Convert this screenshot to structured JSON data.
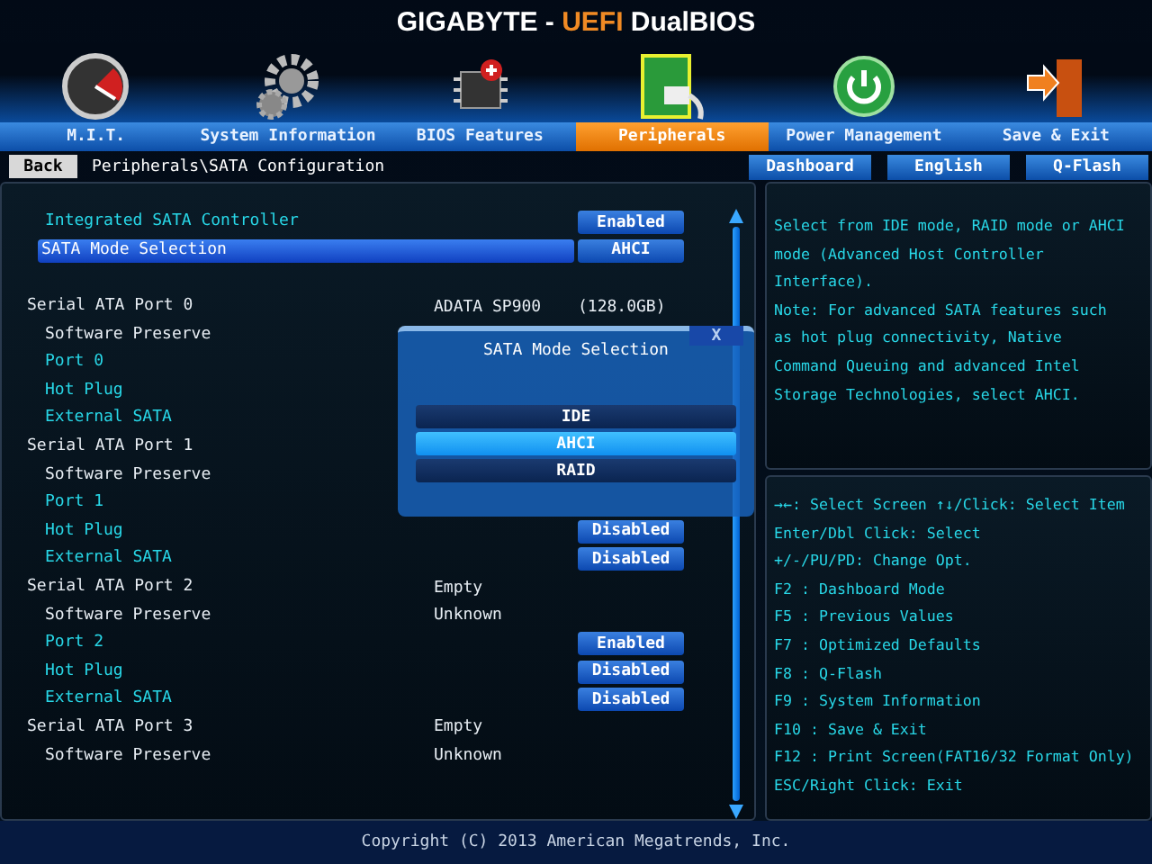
{
  "title": {
    "brand": "GIGABYTE - ",
    "uefi": "UEFI",
    "rest": " DualBIOS"
  },
  "tabs": [
    {
      "label": "M.I.T.",
      "selected": false
    },
    {
      "label": "System Information",
      "selected": false
    },
    {
      "label": "BIOS Features",
      "selected": false
    },
    {
      "label": "Peripherals",
      "selected": true
    },
    {
      "label": "Power Management",
      "selected": false
    },
    {
      "label": "Save & Exit",
      "selected": false
    }
  ],
  "back_button": "Back",
  "breadcrumb": "Peripherals\\SATA Configuration",
  "shortcuts": [
    "Dashboard",
    "English",
    "Q-Flash"
  ],
  "settings": [
    {
      "kind": "option",
      "label": "Integrated SATA Controller",
      "value": "Enabled",
      "selected": false
    },
    {
      "kind": "option",
      "label": "SATA Mode Selection",
      "value": "AHCI",
      "selected": true
    },
    {
      "kind": "spacer"
    },
    {
      "kind": "header",
      "label": "Serial ATA Port 0",
      "value": "ADATA SP900",
      "extra": "(128.0GB)",
      "selected": false
    },
    {
      "kind": "info",
      "label": "Software Preserve",
      "selected": false
    },
    {
      "kind": "option",
      "label": "Port 0",
      "selected": false
    },
    {
      "kind": "option",
      "label": "Hot Plug",
      "selected": false
    },
    {
      "kind": "option",
      "label": "External SATA",
      "selected": false
    },
    {
      "kind": "header",
      "label": "Serial ATA Port 1",
      "selected": false
    },
    {
      "kind": "info",
      "label": "Software Preserve",
      "selected": false
    },
    {
      "kind": "option",
      "label": "Port 1",
      "selected": false
    },
    {
      "kind": "option",
      "label": "Hot Plug",
      "value": "Disabled",
      "selected": false
    },
    {
      "kind": "option",
      "label": "External SATA",
      "value": "Disabled",
      "selected": false
    },
    {
      "kind": "header",
      "label": "Serial ATA Port 2",
      "value": "Empty",
      "selected": false
    },
    {
      "kind": "info",
      "label": "Software Preserve",
      "value": "Unknown",
      "selected": false
    },
    {
      "kind": "option",
      "label": "Port 2",
      "value": "Enabled",
      "selected": false
    },
    {
      "kind": "option",
      "label": "Hot Plug",
      "value": "Disabled",
      "selected": false
    },
    {
      "kind": "option",
      "label": "External SATA",
      "value": "Disabled",
      "selected": false
    },
    {
      "kind": "header",
      "label": "Serial ATA Port 3",
      "value": "Empty",
      "selected": false
    },
    {
      "kind": "info",
      "label": "Software Preserve",
      "value": "Unknown",
      "selected": false
    }
  ],
  "popup": {
    "title": "SATA Mode Selection",
    "close": "X",
    "options": [
      {
        "label": "IDE",
        "selected": false
      },
      {
        "label": "AHCI",
        "selected": true
      },
      {
        "label": "RAID",
        "selected": false
      }
    ]
  },
  "help_lines": [
    "Select from IDE mode, RAID mode or AHCI",
    "mode (Advanced Host Controller",
    "Interface).",
    "Note: For advanced SATA features such",
    "as hot plug connectivity, Native",
    "Command Queuing and advanced Intel",
    "Storage Technologies, select AHCI."
  ],
  "key_lines": [
    "→←: Select Screen  ↑↓/Click: Select Item",
    "Enter/Dbl Click: Select",
    "+/-/PU/PD: Change Opt.",
    "F2  : Dashboard Mode",
    "F5  : Previous Values",
    "F7  : Optimized Defaults",
    "F8  : Q-Flash",
    "F9  : System Information",
    "F10 : Save & Exit",
    "F12 : Print Screen(FAT16/32 Format Only)",
    "ESC/Right Click: Exit"
  ],
  "footer": "Copyright (C) 2013 American Megatrends, Inc."
}
